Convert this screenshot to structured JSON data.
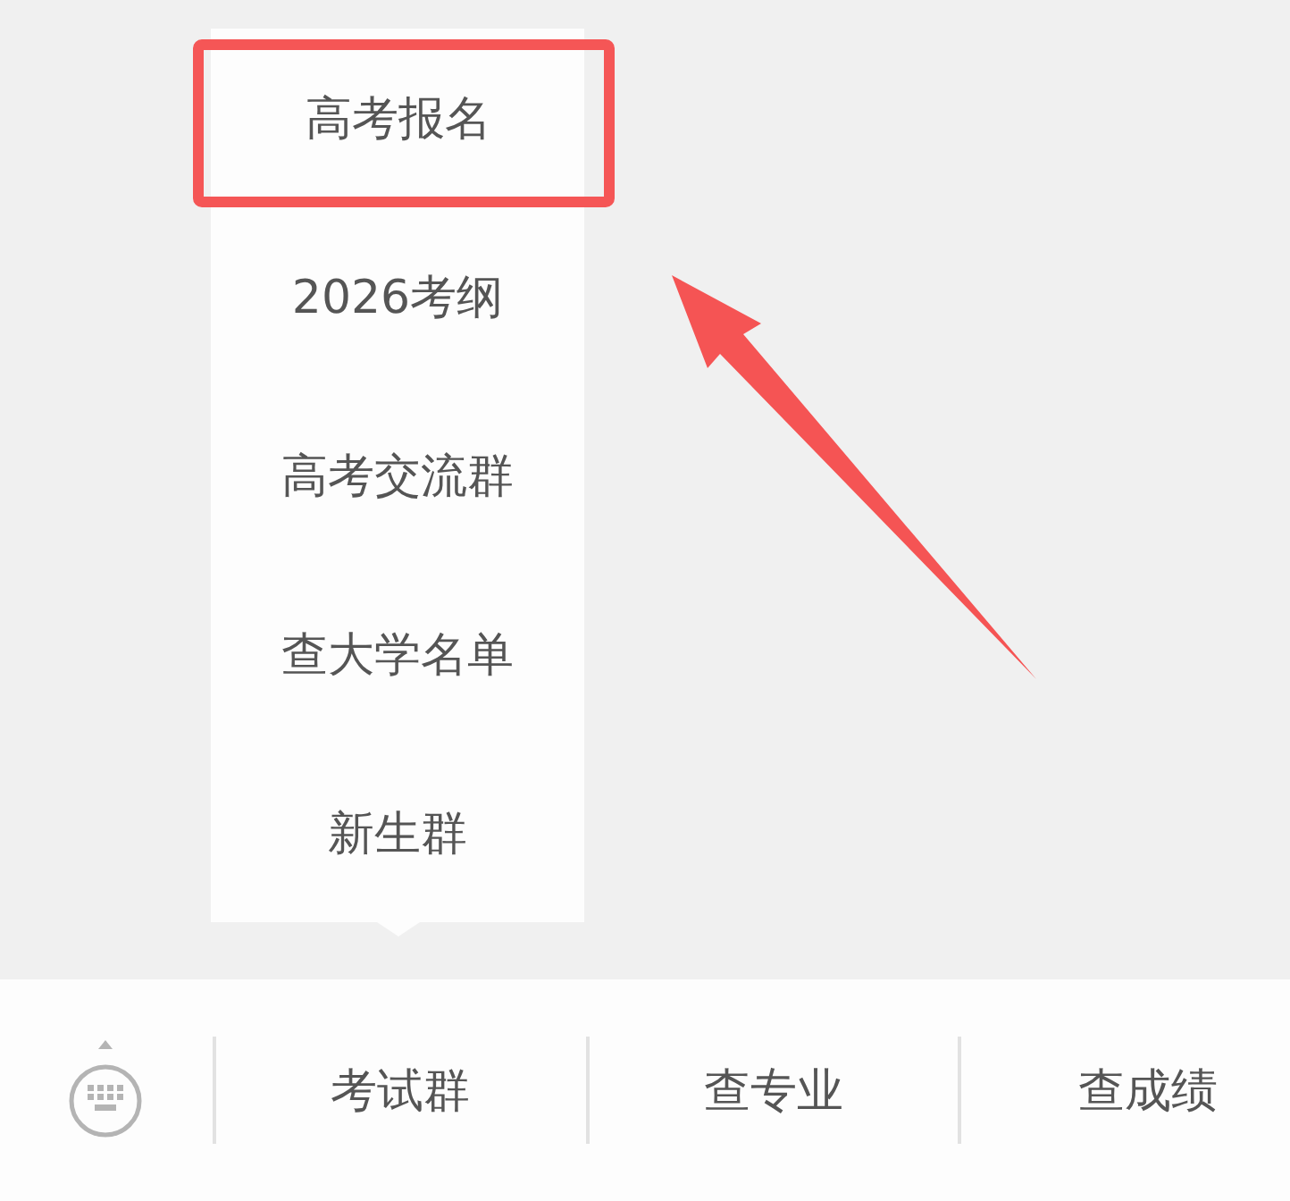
{
  "menu": {
    "items": [
      {
        "label": "高考报名",
        "highlighted": true
      },
      {
        "label": "2026考纲",
        "highlighted": false
      },
      {
        "label": "高考交流群",
        "highlighted": false
      },
      {
        "label": "查大学名单",
        "highlighted": false
      },
      {
        "label": "新生群",
        "highlighted": false
      }
    ]
  },
  "bottom_bar": {
    "tabs": [
      {
        "label": "考试群"
      },
      {
        "label": "查专业"
      },
      {
        "label": "查成绩"
      }
    ]
  }
}
